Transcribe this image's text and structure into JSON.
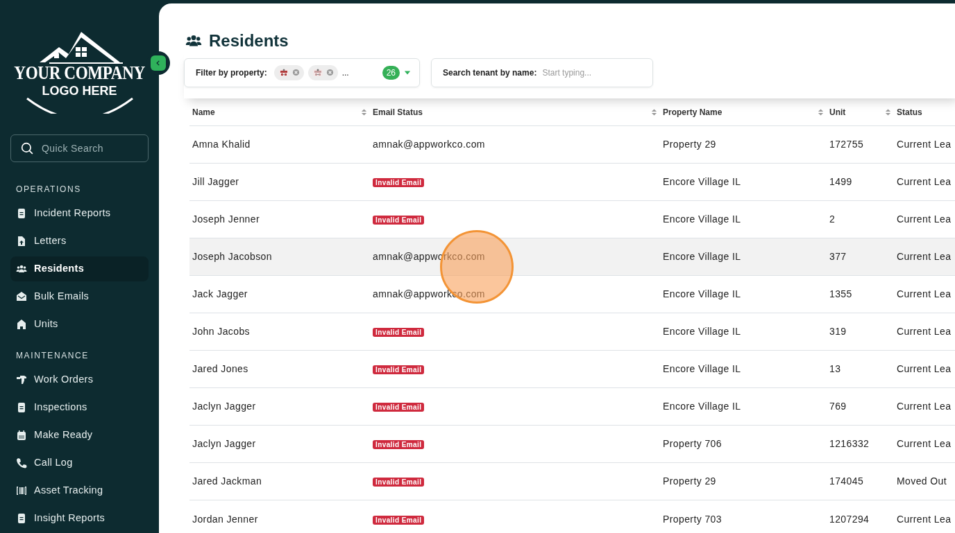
{
  "sidebar": {
    "logo": {
      "line1": "YOUR COMPANY",
      "line2": "LOGO HERE"
    },
    "search": {
      "placeholder": "Quick Search"
    },
    "sections": [
      {
        "title": "OPERATIONS",
        "items": [
          {
            "label": "Incident Reports",
            "selected": false
          },
          {
            "label": "Letters",
            "selected": false
          },
          {
            "label": "Residents",
            "selected": true
          },
          {
            "label": "Bulk Emails",
            "selected": false
          },
          {
            "label": "Units",
            "selected": false
          }
        ]
      },
      {
        "title": "MAINTENANCE",
        "items": [
          {
            "label": "Work Orders",
            "selected": false
          },
          {
            "label": "Inspections",
            "selected": false
          },
          {
            "label": "Make Ready",
            "selected": false
          },
          {
            "label": "Call Log",
            "selected": false
          },
          {
            "label": "Asset Tracking",
            "selected": false
          },
          {
            "label": "Insight Reports",
            "selected": false
          }
        ]
      }
    ]
  },
  "page": {
    "title": "Residents"
  },
  "filter": {
    "label": "Filter by property:",
    "more": "...",
    "count": "26"
  },
  "search": {
    "label": "Search tenant by name:",
    "placeholder": "Start typing..."
  },
  "table": {
    "columns": [
      "Name",
      "Email Status",
      "Property Name",
      "Unit",
      "Status"
    ],
    "rows": [
      {
        "name": "Amna Khalid",
        "email": {
          "kind": "address",
          "text": "amnak@appworkco.com"
        },
        "property": "Property 29",
        "unit": "172755",
        "status": "Current Lea",
        "highlighted": false
      },
      {
        "name": "Jill Jagger",
        "email": {
          "kind": "invalid",
          "text": "Invalid Email"
        },
        "property": "Encore Village IL",
        "unit": "1499",
        "status": "Current Lea",
        "highlighted": false
      },
      {
        "name": "Joseph Jenner",
        "email": {
          "kind": "invalid",
          "text": "Invalid Email"
        },
        "property": "Encore Village IL",
        "unit": "2",
        "status": "Current Lea",
        "highlighted": false
      },
      {
        "name": "Joseph Jacobson",
        "email": {
          "kind": "address",
          "text": "amnak@appworkco.com"
        },
        "property": "Encore Village IL",
        "unit": "377",
        "status": "Current Lea",
        "highlighted": true
      },
      {
        "name": "Jack Jagger",
        "email": {
          "kind": "address",
          "text": "amnak@appworkco.com"
        },
        "property": "Encore Village IL",
        "unit": "1355",
        "status": "Current Lea",
        "highlighted": false
      },
      {
        "name": "John Jacobs",
        "email": {
          "kind": "invalid",
          "text": "Invalid Email"
        },
        "property": "Encore Village IL",
        "unit": "319",
        "status": "Current Lea",
        "highlighted": false
      },
      {
        "name": "Jared Jones",
        "email": {
          "kind": "invalid",
          "text": "Invalid Email"
        },
        "property": "Encore Village IL",
        "unit": "13",
        "status": "Current Lea",
        "highlighted": false
      },
      {
        "name": "Jaclyn Jagger",
        "email": {
          "kind": "invalid",
          "text": "Invalid Email"
        },
        "property": "Encore Village IL",
        "unit": "769",
        "status": "Current Lea",
        "highlighted": false
      },
      {
        "name": "Jaclyn Jagger",
        "email": {
          "kind": "invalid",
          "text": "Invalid Email"
        },
        "property": "Property 706",
        "unit": "1216332",
        "status": "Current Lea",
        "highlighted": false
      },
      {
        "name": "Jared Jackman",
        "email": {
          "kind": "invalid",
          "text": "Invalid Email"
        },
        "property": "Property 29",
        "unit": "174045",
        "status": "Moved Out",
        "highlighted": false
      },
      {
        "name": "Jordan Jenner",
        "email": {
          "kind": "invalid",
          "text": "Invalid Email"
        },
        "property": "Property 703",
        "unit": "1207294",
        "status": "Current Lea",
        "highlighted": false
      }
    ]
  }
}
